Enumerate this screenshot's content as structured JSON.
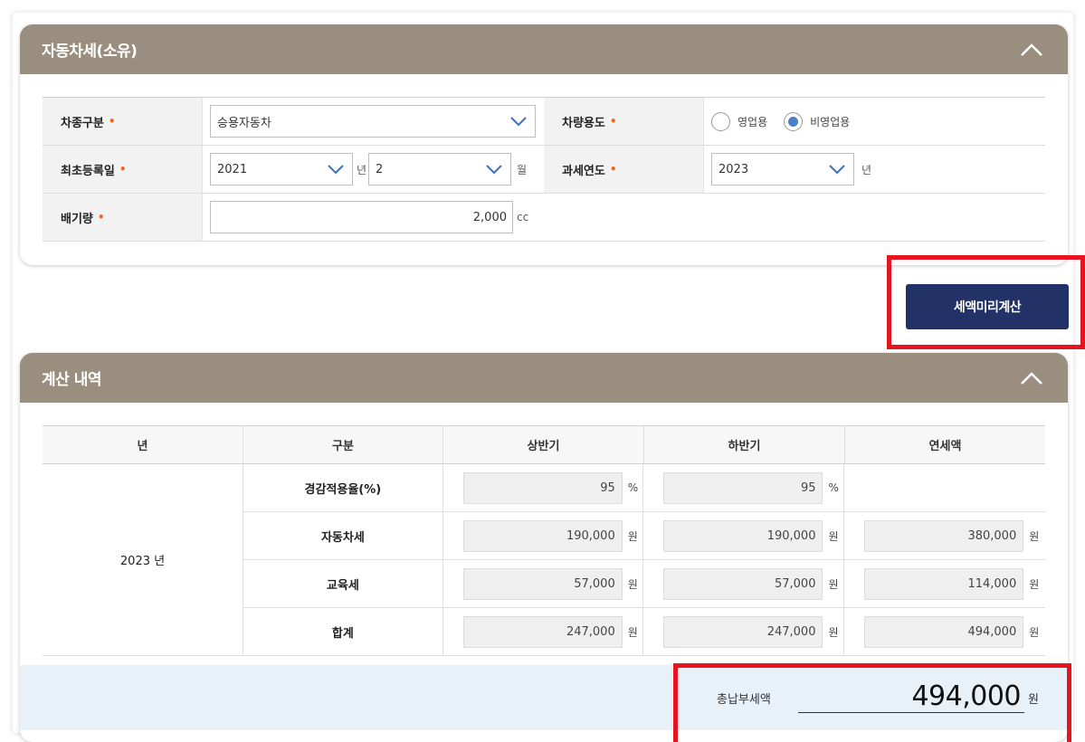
{
  "vehicle_tax": {
    "title": "자동차세(소유)",
    "vehicle_type_label": "차종구분",
    "vehicle_type_value": "승용자동차",
    "usage_label": "차량용도",
    "usage_options": [
      "영업용",
      "비영업용"
    ],
    "usage_selected": "비영업용",
    "first_reg_label": "최초등록일",
    "first_reg_year": "2021",
    "year_unit": "년",
    "first_reg_month": "2",
    "month_unit": "월",
    "tax_year_label": "과세연도",
    "tax_year_value": "2023",
    "displacement_label": "배기량",
    "displacement_value": "2,000",
    "displacement_unit": "cc",
    "required_mark": "•"
  },
  "calc_button": "세액미리계산",
  "result": {
    "title": "계산 내역",
    "headers": [
      "년",
      "구분",
      "상반기",
      "하반기",
      "연세액"
    ],
    "year": "2023 년",
    "rows": [
      {
        "label": "경감적용율(%)",
        "first": "95",
        "second": "95",
        "annual": "",
        "unit": "%"
      },
      {
        "label": "자동차세",
        "first": "190,000",
        "second": "190,000",
        "annual": "380,000",
        "unit": "원"
      },
      {
        "label": "교육세",
        "first": "57,000",
        "second": "57,000",
        "annual": "114,000",
        "unit": "원"
      },
      {
        "label": "합계",
        "first": "247,000",
        "second": "247,000",
        "annual": "494,000",
        "unit": "원"
      }
    ],
    "total_label": "총납부세액",
    "total_value": "494,000",
    "total_unit": "원"
  },
  "colors": {
    "header_bg": "#9a8f7f",
    "button_bg": "#233266",
    "highlight": "#e6141e",
    "required": "#f26522",
    "radio_selected": "#4a7fc9",
    "total_bg": "#e8f0f8"
  }
}
